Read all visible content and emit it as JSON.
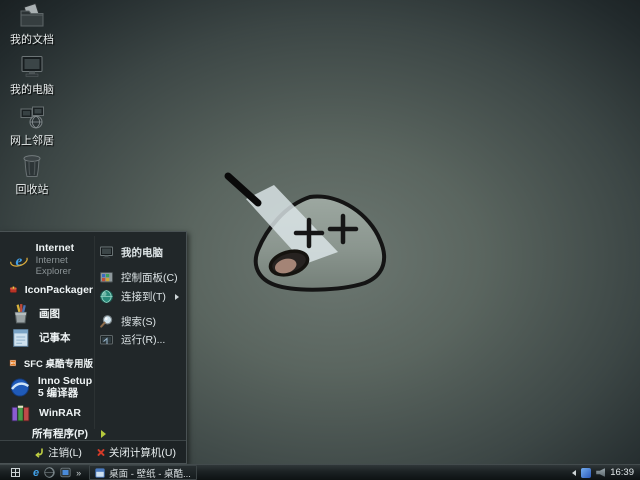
{
  "desktop": {
    "icons": [
      {
        "label": "我的文档"
      },
      {
        "label": "我的电脑"
      },
      {
        "label": "网上邻居"
      },
      {
        "label": "回收站"
      }
    ],
    "wallpaper_mascot": "dead blob character with knife in head, X-shaped eyes"
  },
  "start_menu": {
    "internet": {
      "label": "Internet",
      "sublabel": "Internet Explorer"
    },
    "programs": [
      {
        "label": "IconPackager"
      },
      {
        "label": "画图"
      },
      {
        "label": "记事本"
      },
      {
        "label": "SFC 桌酷专用版"
      },
      {
        "label": "Inno Setup 5 编译器"
      },
      {
        "label": "WinRAR"
      }
    ],
    "all_programs": {
      "label": "所有程序(P)"
    },
    "places": [
      {
        "label": "我的电脑"
      },
      {
        "label": "控制面板(C)"
      },
      {
        "label": "连接到(T)"
      },
      {
        "label": "搜索(S)"
      },
      {
        "label": "运行(R)..."
      }
    ],
    "footer": {
      "logoff": "注销(L)",
      "shutdown": "关闭计算机(U)"
    }
  },
  "taskbar": {
    "overflow_chevron": "»",
    "task_button": {
      "label": "桌面 - 壁纸 - 桌酷..."
    },
    "tray": {
      "time": "16:39"
    }
  },
  "colors": {
    "accent_green": "#b6c93c",
    "shutdown_red": "#d43a28",
    "ie_blue": "#41a0e8",
    "menu_bg": "#212729",
    "wallpaper_center": "#6d7872",
    "wallpaper_edge": "#161c1e"
  }
}
